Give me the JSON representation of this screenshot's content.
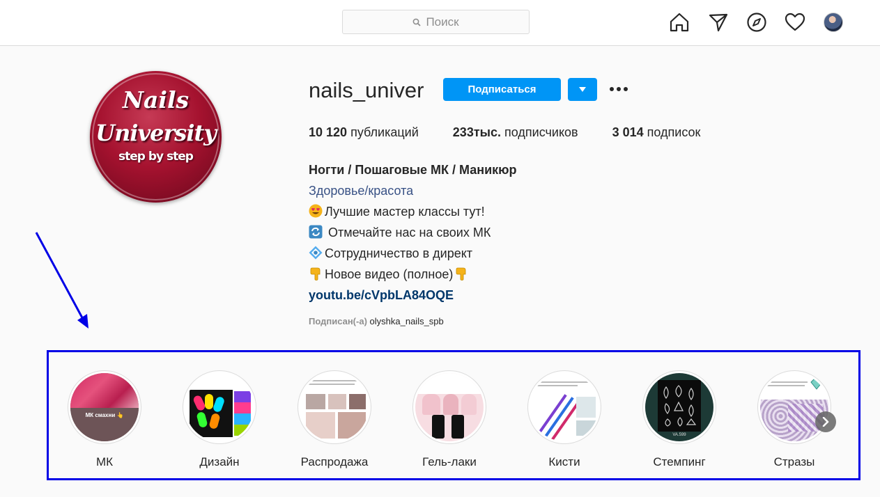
{
  "topbar": {
    "search_placeholder": "Поиск",
    "icons": [
      "home-icon",
      "direct-icon",
      "explore-icon",
      "activity-heart-icon",
      "profile-avatar"
    ]
  },
  "profile": {
    "logo_text": [
      "Nails",
      "University",
      "step by step"
    ],
    "username": "nails_univer",
    "follow_label": "Подписаться",
    "stats": {
      "posts_count": "10 120",
      "posts_label": "публикаций",
      "followers_count": "233тыс.",
      "followers_label": "подписчиков",
      "following_count": "3 014",
      "following_label": "подписок"
    },
    "bio": {
      "name": "Ногти / Пошаговые МК / Маникюр",
      "category": "Здоровье/красота",
      "line1": "Лучшие мастер классы тут!",
      "line2": " Отмечайте нас на своих МК",
      "line3": "Сотрудничество в директ",
      "line4": "Новое видео (полное)",
      "link": "youtu.be/cVpbLA84OQE"
    },
    "followed_by_label": "Подписан(-а)",
    "followed_by_user": "olyshka_nails_spb"
  },
  "highlights": [
    {
      "label": "МК"
    },
    {
      "label": "Дизайн"
    },
    {
      "label": "Распродажа"
    },
    {
      "label": "Гель-лаки"
    },
    {
      "label": "Кисти"
    },
    {
      "label": "Стемпинг"
    },
    {
      "label": "Стразы"
    }
  ],
  "highlight_thumb_text": {
    "mk": "МК смахни 👆",
    "stamping": "VA.599"
  },
  "colors": {
    "accent": "#0095f6",
    "annotation": "#0000e6",
    "link": "#00376b",
    "category": "#385185"
  }
}
